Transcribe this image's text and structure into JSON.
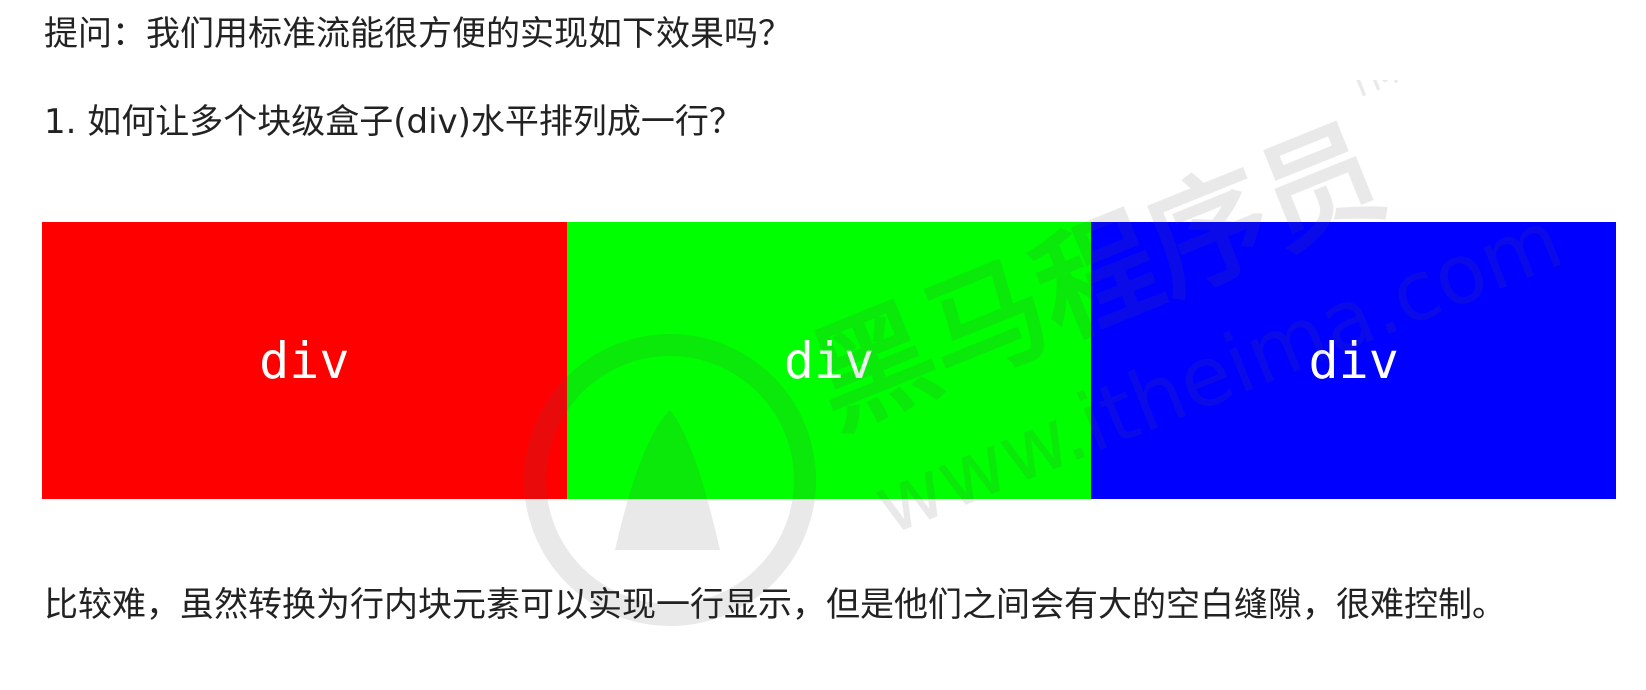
{
  "question": "提问：我们用标准流能很方便的实现如下效果吗？",
  "item_1": "1. 如何让多个块级盒子(div)水平排列成一行？",
  "boxes": [
    {
      "label": "div",
      "color": "#ff0000"
    },
    {
      "label": "div",
      "color": "#00ff00"
    },
    {
      "label": "div",
      "color": "#0000ff"
    }
  ],
  "conclusion": "比较难，虽然转换为行内块元素可以实现一行显示，但是他们之间会有大的空白缝隙，很难控制。",
  "watermark": {
    "brand": "黑马程序员",
    "trademark": "TM",
    "url": "www.itheima.com"
  }
}
